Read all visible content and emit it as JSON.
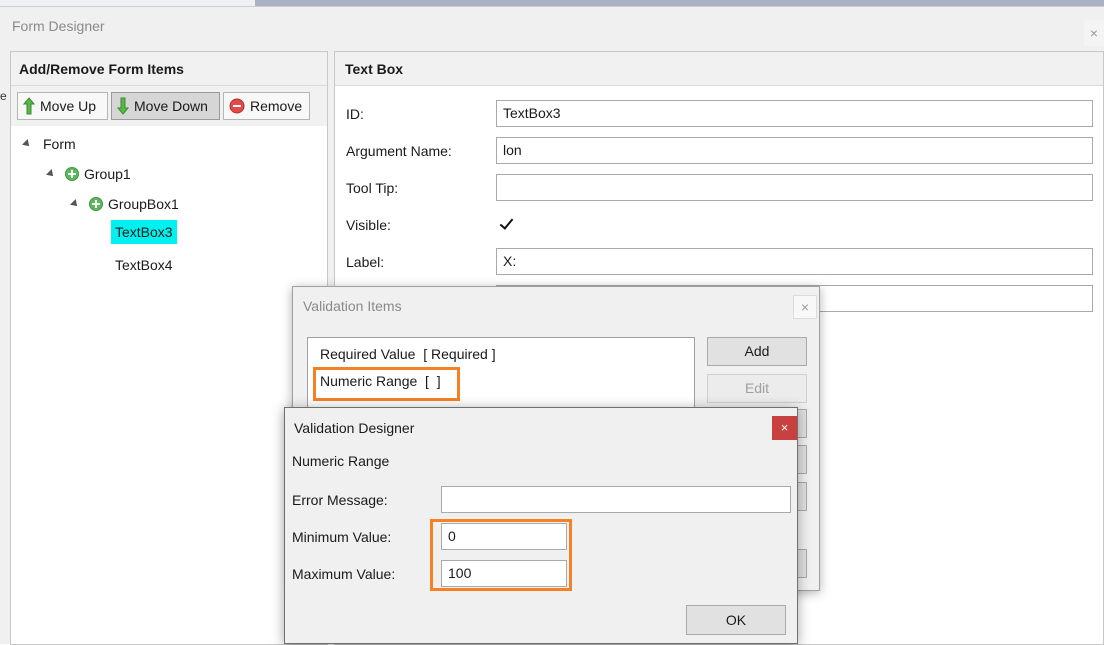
{
  "form_designer": {
    "title": "Form Designer",
    "close_glyph": "×",
    "left_edge_char": "e"
  },
  "left_panel": {
    "header": "Add/Remove Form Items",
    "toolbar": {
      "move_up": "Move Up",
      "move_down": "Move Down",
      "remove": "Remove"
    },
    "tree": {
      "form": "Form",
      "group1": "Group1",
      "groupbox1": "GroupBox1",
      "textbox3": "TextBox3",
      "textbox4": "TextBox4"
    }
  },
  "right_panel": {
    "header": "Text Box",
    "id_label": "ID:",
    "id_value": "TextBox3",
    "argument_label": "Argument Name:",
    "argument_value": "lon",
    "tooltip_label": "Tool Tip:",
    "tooltip_value": "",
    "visible_label": "Visible:",
    "visible_checked": true,
    "label_label": "Label:",
    "label_value": "X:"
  },
  "validation_items": {
    "title": "Validation Items",
    "close_glyph": "×",
    "items": [
      "Required Value  [ Required ]",
      "Numeric Range  [  ]"
    ],
    "add_label": "Add",
    "edit_label": "Edit"
  },
  "validation_designer": {
    "title": "Validation Designer",
    "close_glyph": "×",
    "subtitle": "Numeric Range",
    "error_label": "Error Message:",
    "error_value": "",
    "min_label": "Minimum Value:",
    "min_value": "0",
    "max_label": "Maximum Value:",
    "max_value": "100",
    "ok_label": "OK"
  },
  "colors": {
    "selection": "#00f0f0",
    "highlight": "#f58026",
    "close_red": "#c94040"
  }
}
